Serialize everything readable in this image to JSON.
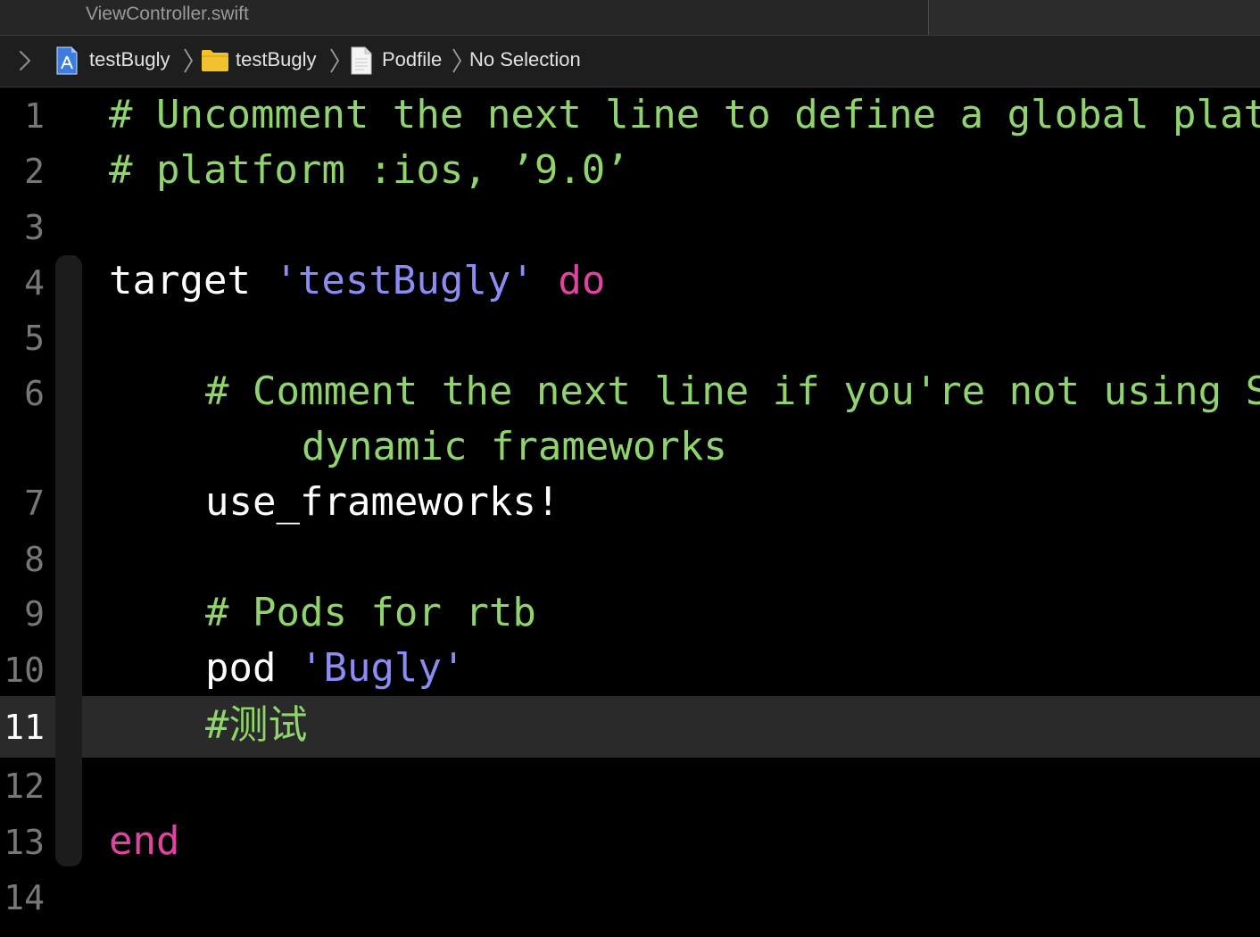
{
  "tab": {
    "title": "ViewController.swift"
  },
  "breadcrumb": {
    "items": [
      {
        "label": "testBugly",
        "icon": "xcode-project-icon"
      },
      {
        "label": "testBugly",
        "icon": "folder-icon"
      },
      {
        "label": "Podfile",
        "icon": "file-icon"
      },
      {
        "label": "No Selection"
      }
    ]
  },
  "editor": {
    "current_line": 11,
    "colors": {
      "comment": "#8fd46c",
      "plain": "#ffffff",
      "string": "#8c8cf5",
      "keyword": "#e044a3",
      "line_number": "#777777",
      "current_line_bg": "#2a2a2a"
    },
    "line_numbers": [
      "1",
      "2",
      "3",
      "4",
      "5",
      "6",
      "7",
      "8",
      "9",
      "10",
      "11",
      "12",
      "13",
      "14"
    ],
    "lines": {
      "l1": "# Uncomment the next line to define a global platform for your project",
      "l2": "# platform :ios, ’9.0’",
      "l4_target": "target ",
      "l4_string": "'testBugly'",
      "l4_do": " do",
      "l6a": "# Comment the next line if you're not using Swift and don't want to use",
      "l6b": "dynamic frameworks",
      "l7": "use_frameworks!",
      "l9": "# Pods for rtb",
      "l10_pod": "pod ",
      "l10_string": "'Bugly'",
      "l11": "#测试",
      "l13": "end"
    }
  }
}
